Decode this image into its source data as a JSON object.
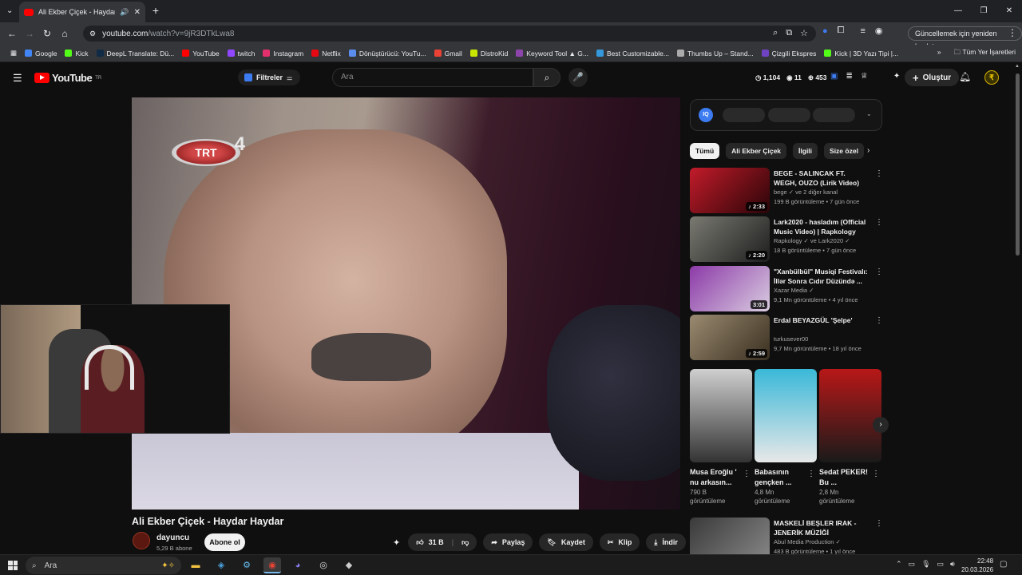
{
  "browser": {
    "tab_title": "Ali Ekber Çiçek - Haydar Ha",
    "url_host": "youtube.com",
    "url_path": "/watch?v=9jR3DTkLwa8",
    "update_label": "Güncellemek için yeniden başlat",
    "bookmarks": [
      {
        "label": "Google",
        "color": "#4285f4"
      },
      {
        "label": "Kick",
        "color": "#53fc18"
      },
      {
        "label": "DeepL Translate: Dü...",
        "color": "#0f2b46"
      },
      {
        "label": "YouTube",
        "color": "#ff0000"
      },
      {
        "label": "twitch",
        "color": "#9146ff"
      },
      {
        "label": "Instagram",
        "color": "#e1306c"
      },
      {
        "label": "Netflix",
        "color": "#e50914"
      },
      {
        "label": "Dönüştürücü: YouTu...",
        "color": "#5a8dee"
      },
      {
        "label": "Gmail",
        "color": "#ea4335"
      },
      {
        "label": "DistroKid",
        "color": "#c8e600"
      },
      {
        "label": "Keyword Tool ▲ G...",
        "color": "#8e44ad"
      },
      {
        "label": "Best Customizable...",
        "color": "#3498db"
      },
      {
        "label": "Thumbs Up – Stand...",
        "color": "#aaaaaa"
      },
      {
        "label": "Çizgili Ekspres",
        "color": "#6f42c1"
      },
      {
        "label": "Kick | 3D Yazı Tipi |...",
        "color": "#53fc18"
      }
    ],
    "all_bookmarks": "Tüm Yer İşaretleri"
  },
  "youtube": {
    "logo": "YouTube",
    "logo_sup": "TR",
    "filter_label": "Filtreler",
    "search_placeholder": "Ara",
    "stats": {
      "likes": "1,104",
      "views": "11",
      "count": "453"
    },
    "create_label": "Oluştur",
    "avatar_letter": "₹"
  },
  "video": {
    "overlay": "TRT",
    "overlay_num": "4",
    "title": "Ali Ekber Çiçek - Haydar Haydar",
    "channel": "dayuncu",
    "subscribers": "5,29 B abone",
    "subscribe_label": "Abone ol",
    "likes": "31 B",
    "share": "Paylaş",
    "save": "Kaydet",
    "clip": "Klip",
    "download": "İndir"
  },
  "sidebar": {
    "iq_logo": "IQ",
    "chips": [
      "Tümü",
      "Ali Ekber Çiçek",
      "İlgili",
      "Size özel"
    ],
    "recommendations": [
      {
        "title": "BEGE - SALINCAK FT. WEGH, OUZO (Lirik Video)",
        "channel": "bege ✓ ve 2 diğer kanal",
        "meta": "199 B görüntüleme • 7 gün önce",
        "duration": "♪ 2:33",
        "color1": "#c21b2a",
        "color2": "#2a0508"
      },
      {
        "title": "Lark2020 - hasladım (Official Music Video) | Rapkology",
        "channel": "Rapkology ✓ ve Lark2020 ✓",
        "meta": "18 B görüntüleme • 7 gün önce",
        "duration": "♪ 2:20",
        "color1": "#7a7a72",
        "color2": "#1e1e1e"
      },
      {
        "title": "\"Xanbülbül\" Musiqi Festivalı: İllər Sonra Cıdır Düzündə ...",
        "channel": "Xazar Media ✓",
        "meta": "9,1 Mn görüntüleme • 4 yıl önce",
        "duration": "3:01",
        "color1": "#8c3aa8",
        "color2": "#d9cce0"
      },
      {
        "title": "Erdal BEYAZGÜL 'Şelpe'",
        "channel": "turkusever00",
        "meta": "9,7 Mn görüntüleme • 18 yıl önce",
        "duration": "♪ 2:59",
        "color1": "#9a8a70",
        "color2": "#3a3020"
      }
    ],
    "shorts": [
      {
        "title": "Musa Eroğlu ' nu arkasın...",
        "views": "790 B görüntüleme",
        "color1": "#cfcfcf",
        "color2": "#333333"
      },
      {
        "title": "Babasının gençken ...",
        "views": "4,8 Mn görüntüleme",
        "color1": "#3ab8d8",
        "color2": "#e8e8e8"
      },
      {
        "title": "Sedat PEKER! Bu ...",
        "views": "2,8 Mn görüntüleme",
        "color1": "#b81818",
        "color2": "#1a1a1a"
      }
    ],
    "bottom_rec": {
      "title": "MASKELİ BEŞLER IRAK - JENERİK MÜZİĞİ",
      "channel": "Abul Media Production ✓",
      "meta": "483 B görüntüleme • 1 yıl önce",
      "color1": "#3a3a3a",
      "color2": "#888888"
    }
  },
  "taskbar": {
    "search_label": "Ara",
    "time": "22:48",
    "date": "20.03.2026"
  }
}
